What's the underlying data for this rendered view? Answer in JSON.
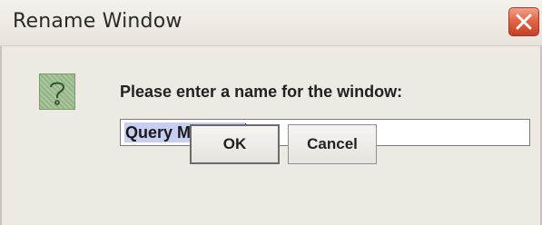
{
  "window": {
    "title": "Rename Window"
  },
  "dialog": {
    "icon": "question-icon",
    "prompt": "Please enter a name for the window:",
    "name_input_value": "Query Manager"
  },
  "buttons": {
    "ok_label": "OK",
    "cancel_label": "Cancel"
  },
  "colors": {
    "close_button": "#e06748",
    "selection_highlight": "#c8cdf2",
    "dialog_background": "#ede9e3"
  }
}
